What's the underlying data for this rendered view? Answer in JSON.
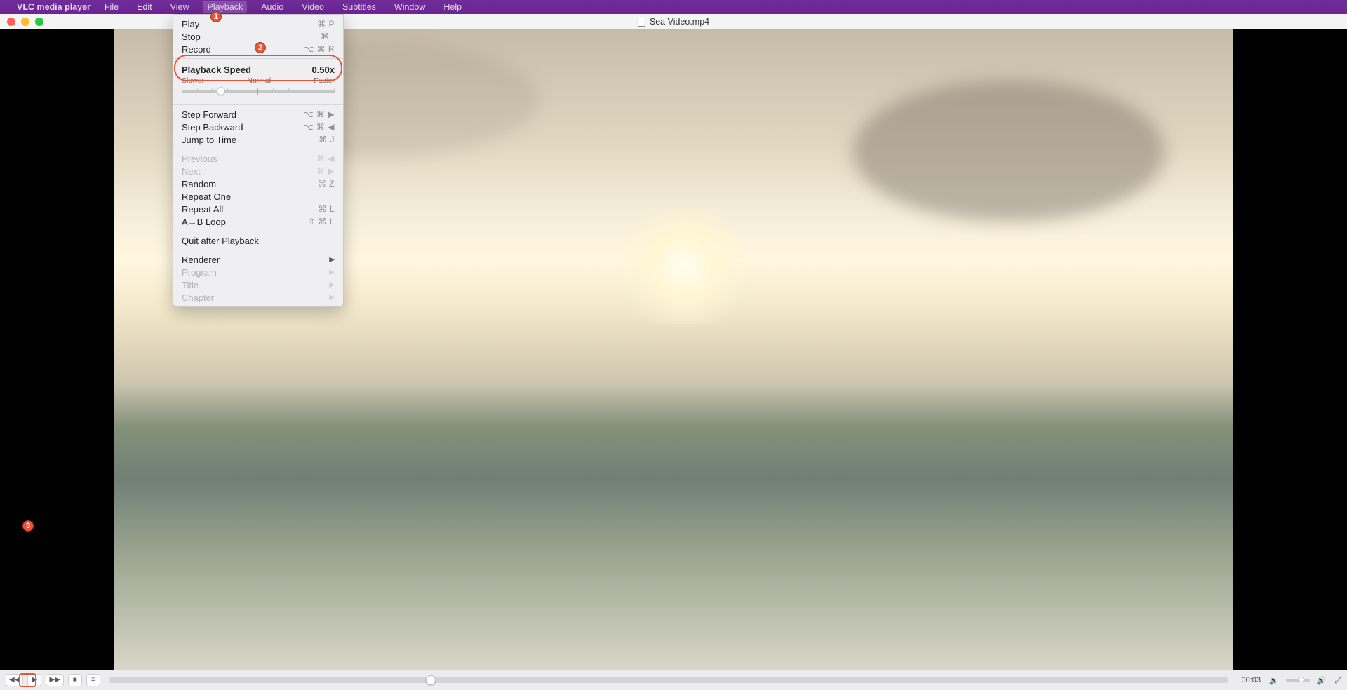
{
  "menubar": {
    "app": "VLC media player",
    "items": {
      "file": "File",
      "edit": "Edit",
      "view": "View",
      "playback": "Playback",
      "audio": "Audio",
      "video": "Video",
      "subtitles": "Subtitles",
      "window": "Window",
      "help": "Help"
    }
  },
  "window": {
    "title": "Sea Video.mp4"
  },
  "dropdown": {
    "play": {
      "label": "Play",
      "shortcut": "⌘ P"
    },
    "stop": {
      "label": "Stop",
      "shortcut": "⌘ ."
    },
    "record": {
      "label": "Record",
      "shortcut": "⌥ ⌘ R"
    },
    "speed": {
      "label": "Playback Speed",
      "value": "0.50x",
      "slower": "Slower",
      "normal": "Normal",
      "faster": "Faster"
    },
    "step_forward": {
      "label": "Step Forward",
      "shortcut": "⌥ ⌘ ▶"
    },
    "step_backward": {
      "label": "Step Backward",
      "shortcut": "⌥ ⌘ ◀"
    },
    "jump_to_time": {
      "label": "Jump to Time",
      "shortcut": "⌘ J"
    },
    "previous": {
      "label": "Previous",
      "shortcut": "⌘ ◀"
    },
    "next": {
      "label": "Next",
      "shortcut": "⌘ ▶"
    },
    "random": {
      "label": "Random",
      "shortcut": "⌘ Z"
    },
    "repeat_one": {
      "label": "Repeat One"
    },
    "repeat_all": {
      "label": "Repeat All",
      "shortcut": "⌘ L"
    },
    "ab_loop": {
      "label": "A→B Loop",
      "shortcut": "⇧ ⌘ L"
    },
    "quit_after": {
      "label": "Quit after Playback"
    },
    "renderer": {
      "label": "Renderer"
    },
    "program": {
      "label": "Program"
    },
    "title": {
      "label": "Title"
    },
    "chapter": {
      "label": "Chapter"
    }
  },
  "annotations": {
    "n1": "1",
    "n2": "2",
    "n3": "3"
  },
  "controls": {
    "time": "00:03"
  }
}
